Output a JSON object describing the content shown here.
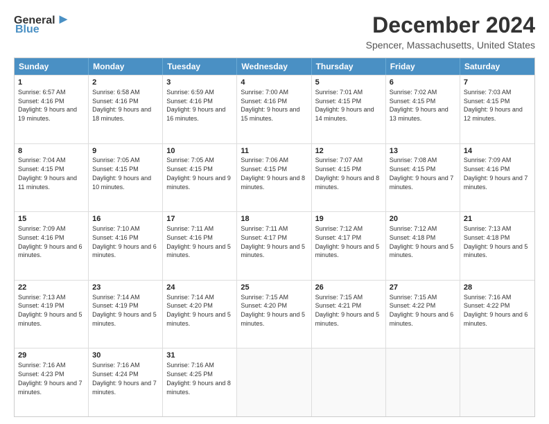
{
  "header": {
    "logo_line1": "General",
    "logo_line2": "Blue",
    "title": "December 2024",
    "subtitle": "Spencer, Massachusetts, United States"
  },
  "calendar": {
    "days_of_week": [
      "Sunday",
      "Monday",
      "Tuesday",
      "Wednesday",
      "Thursday",
      "Friday",
      "Saturday"
    ],
    "weeks": [
      [
        {
          "day": "1",
          "sunrise": "6:57 AM",
          "sunset": "4:16 PM",
          "daylight": "9 hours and 19 minutes."
        },
        {
          "day": "2",
          "sunrise": "6:58 AM",
          "sunset": "4:16 PM",
          "daylight": "9 hours and 18 minutes."
        },
        {
          "day": "3",
          "sunrise": "6:59 AM",
          "sunset": "4:16 PM",
          "daylight": "9 hours and 16 minutes."
        },
        {
          "day": "4",
          "sunrise": "7:00 AM",
          "sunset": "4:16 PM",
          "daylight": "9 hours and 15 minutes."
        },
        {
          "day": "5",
          "sunrise": "7:01 AM",
          "sunset": "4:15 PM",
          "daylight": "9 hours and 14 minutes."
        },
        {
          "day": "6",
          "sunrise": "7:02 AM",
          "sunset": "4:15 PM",
          "daylight": "9 hours and 13 minutes."
        },
        {
          "day": "7",
          "sunrise": "7:03 AM",
          "sunset": "4:15 PM",
          "daylight": "9 hours and 12 minutes."
        }
      ],
      [
        {
          "day": "8",
          "sunrise": "7:04 AM",
          "sunset": "4:15 PM",
          "daylight": "9 hours and 11 minutes."
        },
        {
          "day": "9",
          "sunrise": "7:05 AM",
          "sunset": "4:15 PM",
          "daylight": "9 hours and 10 minutes."
        },
        {
          "day": "10",
          "sunrise": "7:05 AM",
          "sunset": "4:15 PM",
          "daylight": "9 hours and 9 minutes."
        },
        {
          "day": "11",
          "sunrise": "7:06 AM",
          "sunset": "4:15 PM",
          "daylight": "9 hours and 8 minutes."
        },
        {
          "day": "12",
          "sunrise": "7:07 AM",
          "sunset": "4:15 PM",
          "daylight": "9 hours and 8 minutes."
        },
        {
          "day": "13",
          "sunrise": "7:08 AM",
          "sunset": "4:15 PM",
          "daylight": "9 hours and 7 minutes."
        },
        {
          "day": "14",
          "sunrise": "7:09 AM",
          "sunset": "4:16 PM",
          "daylight": "9 hours and 7 minutes."
        }
      ],
      [
        {
          "day": "15",
          "sunrise": "7:09 AM",
          "sunset": "4:16 PM",
          "daylight": "9 hours and 6 minutes."
        },
        {
          "day": "16",
          "sunrise": "7:10 AM",
          "sunset": "4:16 PM",
          "daylight": "9 hours and 6 minutes."
        },
        {
          "day": "17",
          "sunrise": "7:11 AM",
          "sunset": "4:16 PM",
          "daylight": "9 hours and 5 minutes."
        },
        {
          "day": "18",
          "sunrise": "7:11 AM",
          "sunset": "4:17 PM",
          "daylight": "9 hours and 5 minutes."
        },
        {
          "day": "19",
          "sunrise": "7:12 AM",
          "sunset": "4:17 PM",
          "daylight": "9 hours and 5 minutes."
        },
        {
          "day": "20",
          "sunrise": "7:12 AM",
          "sunset": "4:18 PM",
          "daylight": "9 hours and 5 minutes."
        },
        {
          "day": "21",
          "sunrise": "7:13 AM",
          "sunset": "4:18 PM",
          "daylight": "9 hours and 5 minutes."
        }
      ],
      [
        {
          "day": "22",
          "sunrise": "7:13 AM",
          "sunset": "4:19 PM",
          "daylight": "9 hours and 5 minutes."
        },
        {
          "day": "23",
          "sunrise": "7:14 AM",
          "sunset": "4:19 PM",
          "daylight": "9 hours and 5 minutes."
        },
        {
          "day": "24",
          "sunrise": "7:14 AM",
          "sunset": "4:20 PM",
          "daylight": "9 hours and 5 minutes."
        },
        {
          "day": "25",
          "sunrise": "7:15 AM",
          "sunset": "4:20 PM",
          "daylight": "9 hours and 5 minutes."
        },
        {
          "day": "26",
          "sunrise": "7:15 AM",
          "sunset": "4:21 PM",
          "daylight": "9 hours and 5 minutes."
        },
        {
          "day": "27",
          "sunrise": "7:15 AM",
          "sunset": "4:22 PM",
          "daylight": "9 hours and 6 minutes."
        },
        {
          "day": "28",
          "sunrise": "7:16 AM",
          "sunset": "4:22 PM",
          "daylight": "9 hours and 6 minutes."
        }
      ],
      [
        {
          "day": "29",
          "sunrise": "7:16 AM",
          "sunset": "4:23 PM",
          "daylight": "9 hours and 7 minutes."
        },
        {
          "day": "30",
          "sunrise": "7:16 AM",
          "sunset": "4:24 PM",
          "daylight": "9 hours and 7 minutes."
        },
        {
          "day": "31",
          "sunrise": "7:16 AM",
          "sunset": "4:25 PM",
          "daylight": "9 hours and 8 minutes."
        },
        null,
        null,
        null,
        null
      ]
    ]
  }
}
